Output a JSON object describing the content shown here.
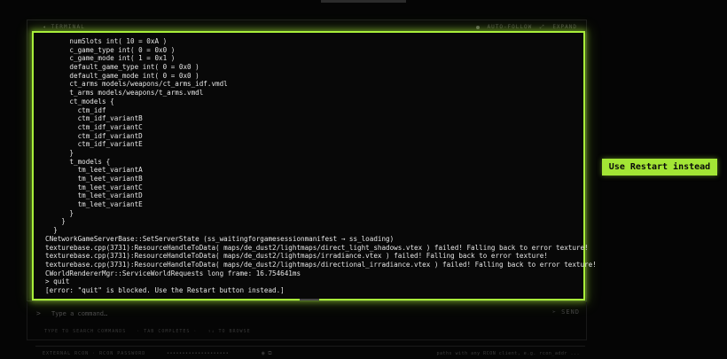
{
  "terminal": {
    "title": "◂ TERMINAL",
    "auto_follow": "AUTO-FOLLOW",
    "expand_icon": "expand-icon",
    "expand": "EXPAND",
    "lines": [
      "      numSlots int( 10 = 0xA )",
      "      c_game_type int( 0 = 0x0 )",
      "      c_game_mode int( 1 = 0x1 )",
      "      default_game_type int( 0 = 0x0 )",
      "      default_game_mode int( 0 = 0x0 )",
      "      ct_arms models/weapons/ct_arms_idf.vmdl",
      "      t_arms models/weapons/t_arms.vmdl",
      "      ct_models {",
      "        ctm_idf",
      "        ctm_idf_variantB",
      "        ctm_idf_variantC",
      "        ctm_idf_variantD",
      "        ctm_idf_variantE",
      "      }",
      "      t_models {",
      "        tm_leet_variantA",
      "        tm_leet_variantB",
      "        tm_leet_variantC",
      "        tm_leet_variantD",
      "        tm_leet_variantE",
      "      }",
      "    }",
      "  }",
      "CNetworkGameServerBase::SetServerState (ss_waitingforgamesessionmanifest → ss_loading)",
      "texturebase.cpp(3731):ResourceHandleToData( maps/de_dust2/lightmaps/direct_light_shadows.vtex ) failed! Falling back to error texture!",
      "texturebase.cpp(3731):ResourceHandleToData( maps/de_dust2/lightmaps/irradiance.vtex ) failed! Falling back to error texture!",
      "texturebase.cpp(3731):ResourceHandleToData( maps/de_dust2/lightmaps/directional_irradiance.vtex ) failed! Falling back to error texture!",
      "CWorldRendererMgr::ServiceWorldRequests long frame: 16.754641ms",
      "> quit",
      "[error: \"quit\" is blocked. Use the Restart button instead.]"
    ]
  },
  "callout": {
    "text": "Use Restart instead"
  },
  "command": {
    "prompt": ">",
    "placeholder": "Type a command…",
    "send_icon": "send-icon",
    "send_label": "SEND"
  },
  "hints": [
    "TYPE TO SEARCH COMMANDS",
    "· TAB COMPLETES ·",
    "↑↓ TO BROWSE"
  ],
  "rcon": {
    "label": "EXTERNAL RCON",
    "password_label": "· RCON PASSWORD",
    "password_value": "••••••••••••••••••••",
    "note": "paths with any RCON client, e.g. rcon_addr ..."
  },
  "colors": {
    "accent": "#a3e635",
    "background": "#050505"
  }
}
